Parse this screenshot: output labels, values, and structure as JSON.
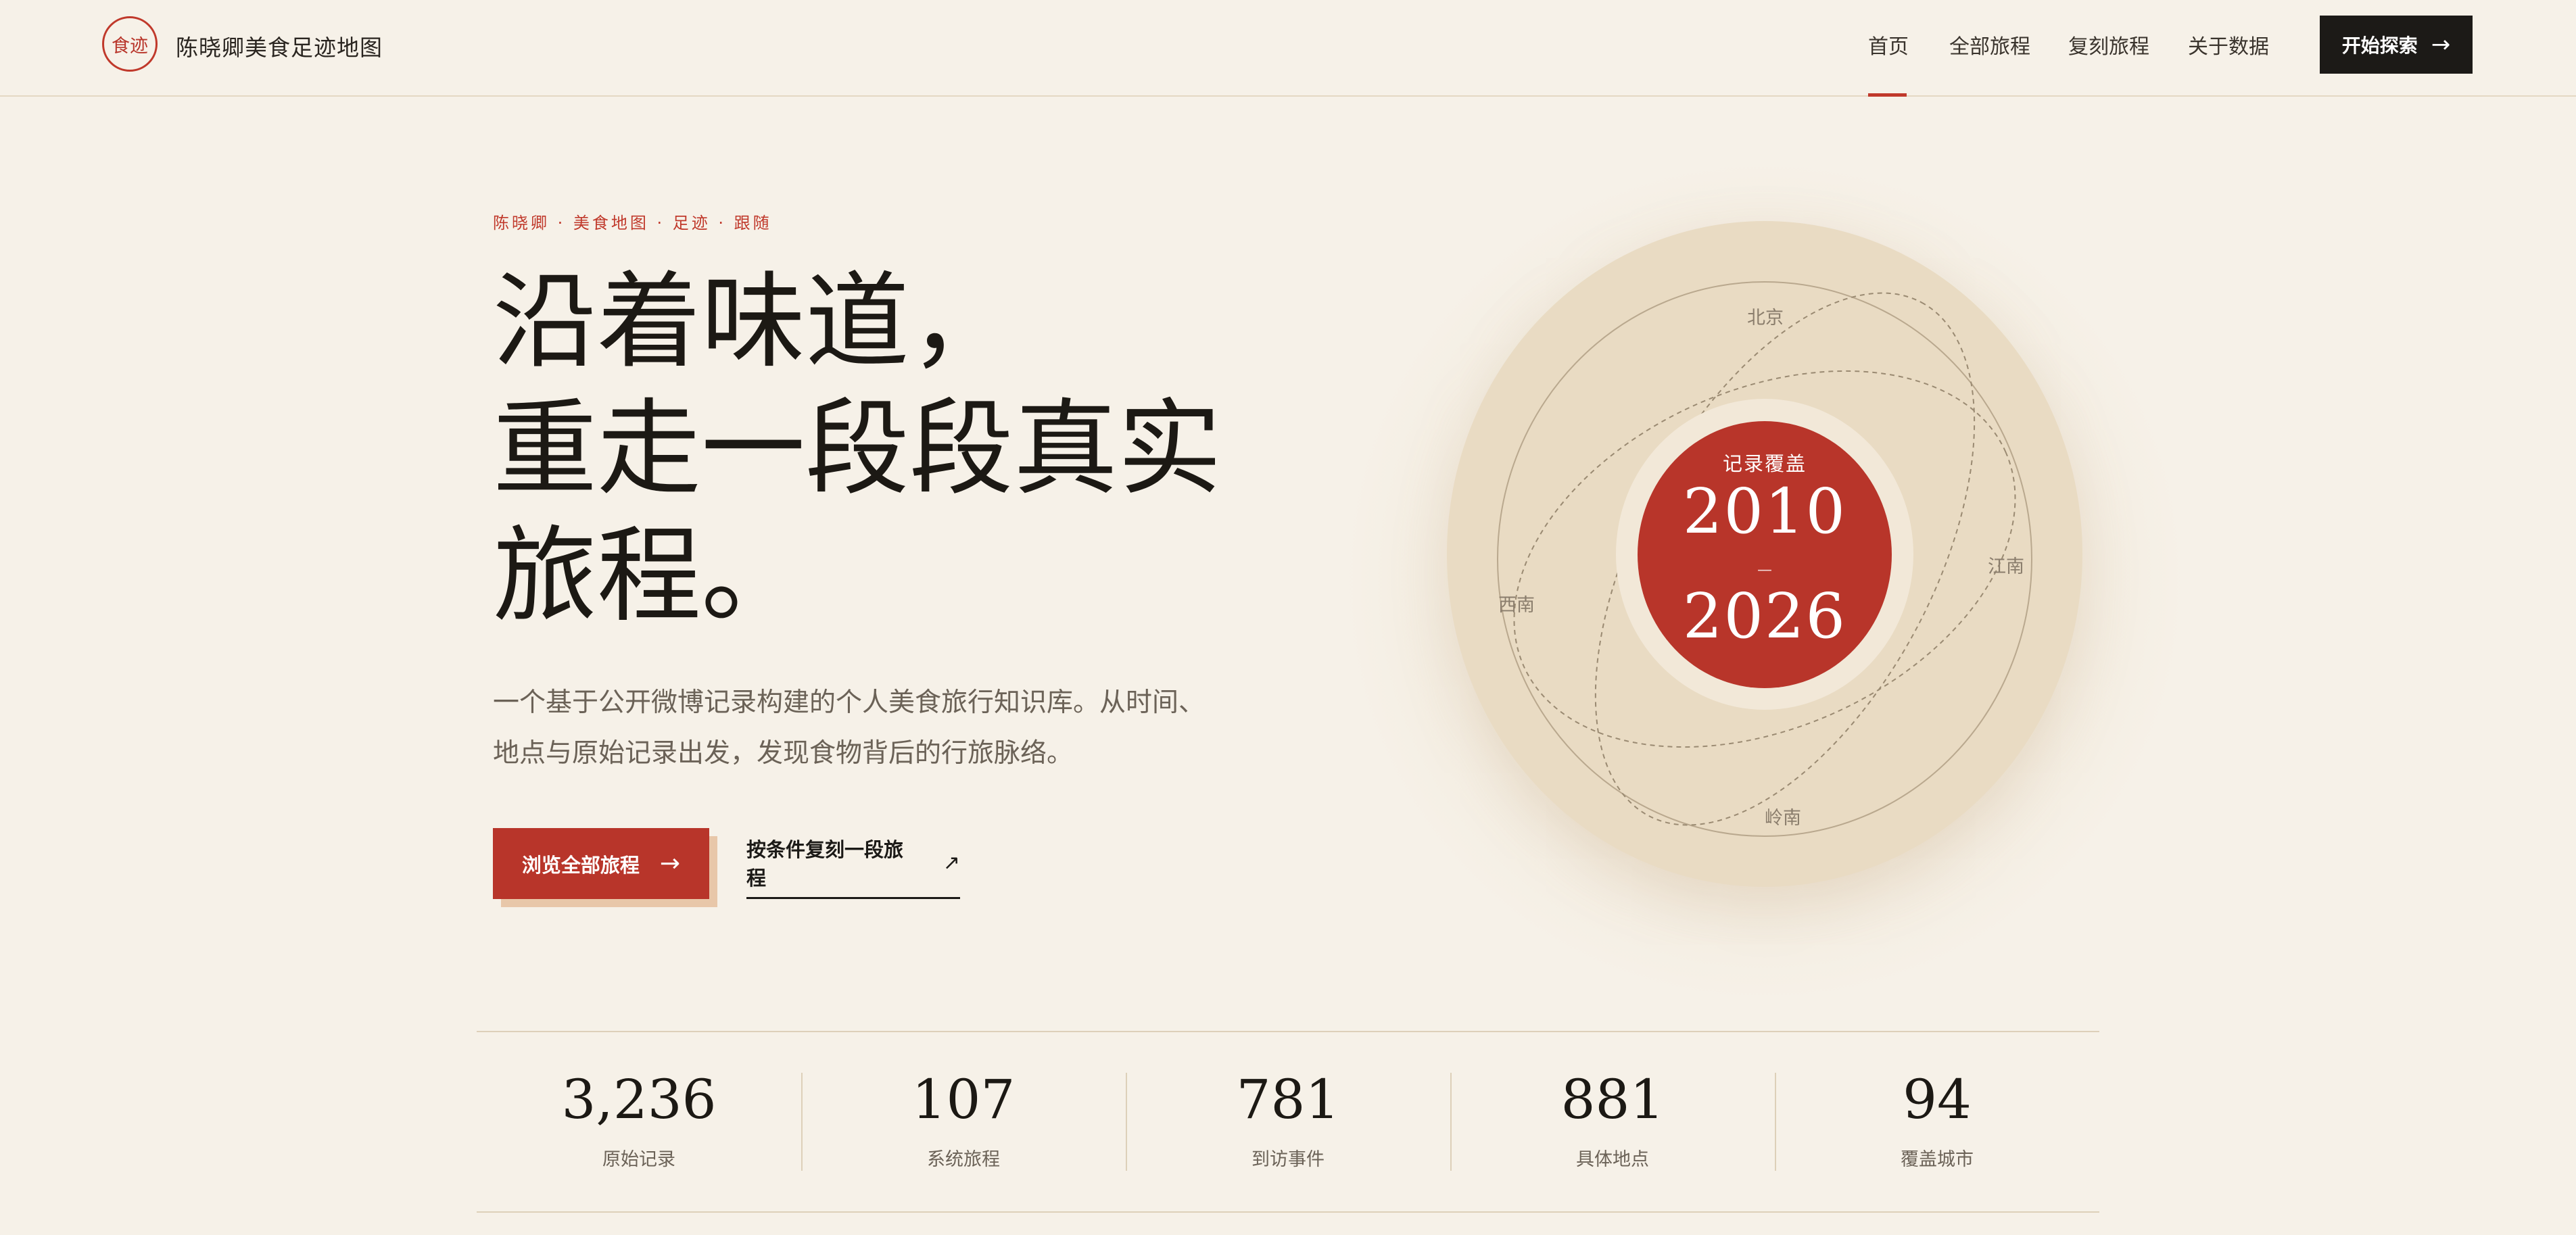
{
  "header": {
    "logo_text": "食迹",
    "site_title": "陈晓卿美食足迹地图",
    "nav": [
      "首页",
      "全部旅程",
      "复刻旅程",
      "关于数据"
    ],
    "active_nav": "首页",
    "cta_label": "开始探索",
    "cta_arrow": "→"
  },
  "hero": {
    "eyebrow": "陈晓卿 · 美食地图 · 足迹 · 跟随",
    "headline": [
      "沿着味道，",
      "重走一段段真实",
      "旅程。"
    ],
    "lead": [
      "一个基于公开微博记录构建的个人美食旅行知识库。从时间、",
      "地点与原始记录出发，发现食物背后的行旅脉络。"
    ],
    "primary_button": "浏览全部旅程",
    "primary_arrow": "→",
    "secondary_button": "按条件复刻一段旅程",
    "secondary_arrow": "↗"
  },
  "map": {
    "center_label": "记录覆盖",
    "year_start": "2010",
    "year_separator": "—",
    "year_end": "2026",
    "regions": {
      "north": "北京",
      "east": "江南",
      "west": "西南",
      "south": "岭南"
    }
  },
  "stats": [
    {
      "value": "3,236",
      "label": "原始记录"
    },
    {
      "value": "107",
      "label": "系统旅程"
    },
    {
      "value": "781",
      "label": "到访事件"
    },
    {
      "value": "881",
      "label": "具体地点"
    },
    {
      "value": "94",
      "label": "覆盖城市"
    }
  ],
  "colors": {
    "background": "#f6f1e8",
    "accent_red": "#b8352a",
    "dark": "#1c1a17",
    "disc": "#e9dbc3"
  }
}
